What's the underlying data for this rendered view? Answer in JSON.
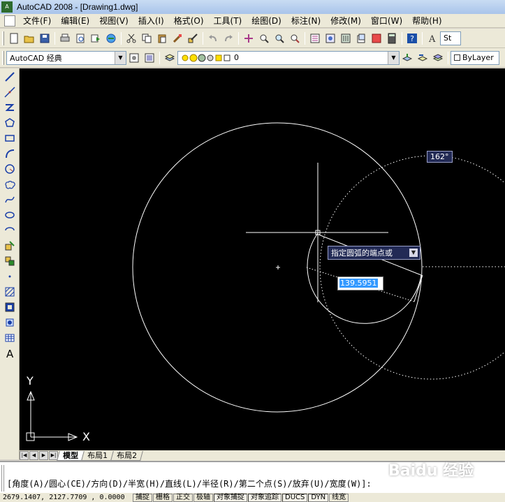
{
  "window": {
    "title": "AutoCAD 2008 - [Drawing1.dwg]",
    "app_icon_text": "A"
  },
  "menu": [
    "文件(F)",
    "编辑(E)",
    "视图(V)",
    "插入(I)",
    "格式(O)",
    "工具(T)",
    "绘图(D)",
    "标注(N)",
    "修改(M)",
    "窗口(W)",
    "帮助(H)"
  ],
  "toolbar1": {
    "icons": [
      "new-icon",
      "open-icon",
      "save-icon",
      "plot-icon",
      "plot-preview-icon",
      "publish-icon",
      "3d-dwf-icon",
      "cut-icon",
      "copy-icon",
      "paste-icon",
      "match-properties-icon",
      "block-editor-icon",
      "undo-icon",
      "redo-icon",
      "pan-icon",
      "zoom-realtime-icon",
      "zoom-window-icon",
      "zoom-previous-icon",
      "properties-icon",
      "design-center-icon",
      "tool-palettes-icon",
      "sheet-set-icon",
      "markup-icon",
      "calculator-icon",
      "help-icon",
      "text-style-icon"
    ],
    "text_style_value": "St"
  },
  "toolbar2": {
    "workspace_value": "AutoCAD 经典",
    "layer_value": "0",
    "linetype_value": "ByLayer"
  },
  "left_tools": [
    "line-icon",
    "construction-line-icon",
    "polyline-icon",
    "polygon-icon",
    "rectangle-icon",
    "arc-icon",
    "circle-icon",
    "revision-cloud-icon",
    "spline-icon",
    "ellipse-icon",
    "ellipse-arc-icon",
    "insert-block-icon",
    "make-block-icon",
    "point-icon",
    "hatch-icon",
    "gradient-icon",
    "region-icon",
    "table-icon",
    "multiline-text-icon"
  ],
  "canvas": {
    "angle_tooltip": "162°",
    "prompt_tooltip": "指定圆弧的端点或",
    "radius_input_value": "139.5951",
    "ucs_x_label": "X",
    "ucs_y_label": "Y"
  },
  "layout_tabs": {
    "tabs": [
      "模型",
      "布局1",
      "布局2"
    ],
    "active": "模型"
  },
  "command_line": {
    "text": "[角度(A)/圆心(CE)/方向(D)/半宽(H)/直线(L)/半径(R)/第二个点(S)/放弃(U)/宽度(W)]:"
  },
  "status_bar": {
    "coordinates": "2679.1407, 2127.7709 , 0.0000",
    "buttons": [
      {
        "label": "捕捉",
        "on": false
      },
      {
        "label": "栅格",
        "on": false
      },
      {
        "label": "正交",
        "on": false
      },
      {
        "label": "极轴",
        "on": false
      },
      {
        "label": "对象捕捉",
        "on": true
      },
      {
        "label": "对象追踪",
        "on": true
      },
      {
        "label": "DUCS",
        "on": true
      },
      {
        "label": "DYN",
        "on": true
      },
      {
        "label": "线宽",
        "on": false
      }
    ]
  },
  "watermark": "Baidu 经验"
}
